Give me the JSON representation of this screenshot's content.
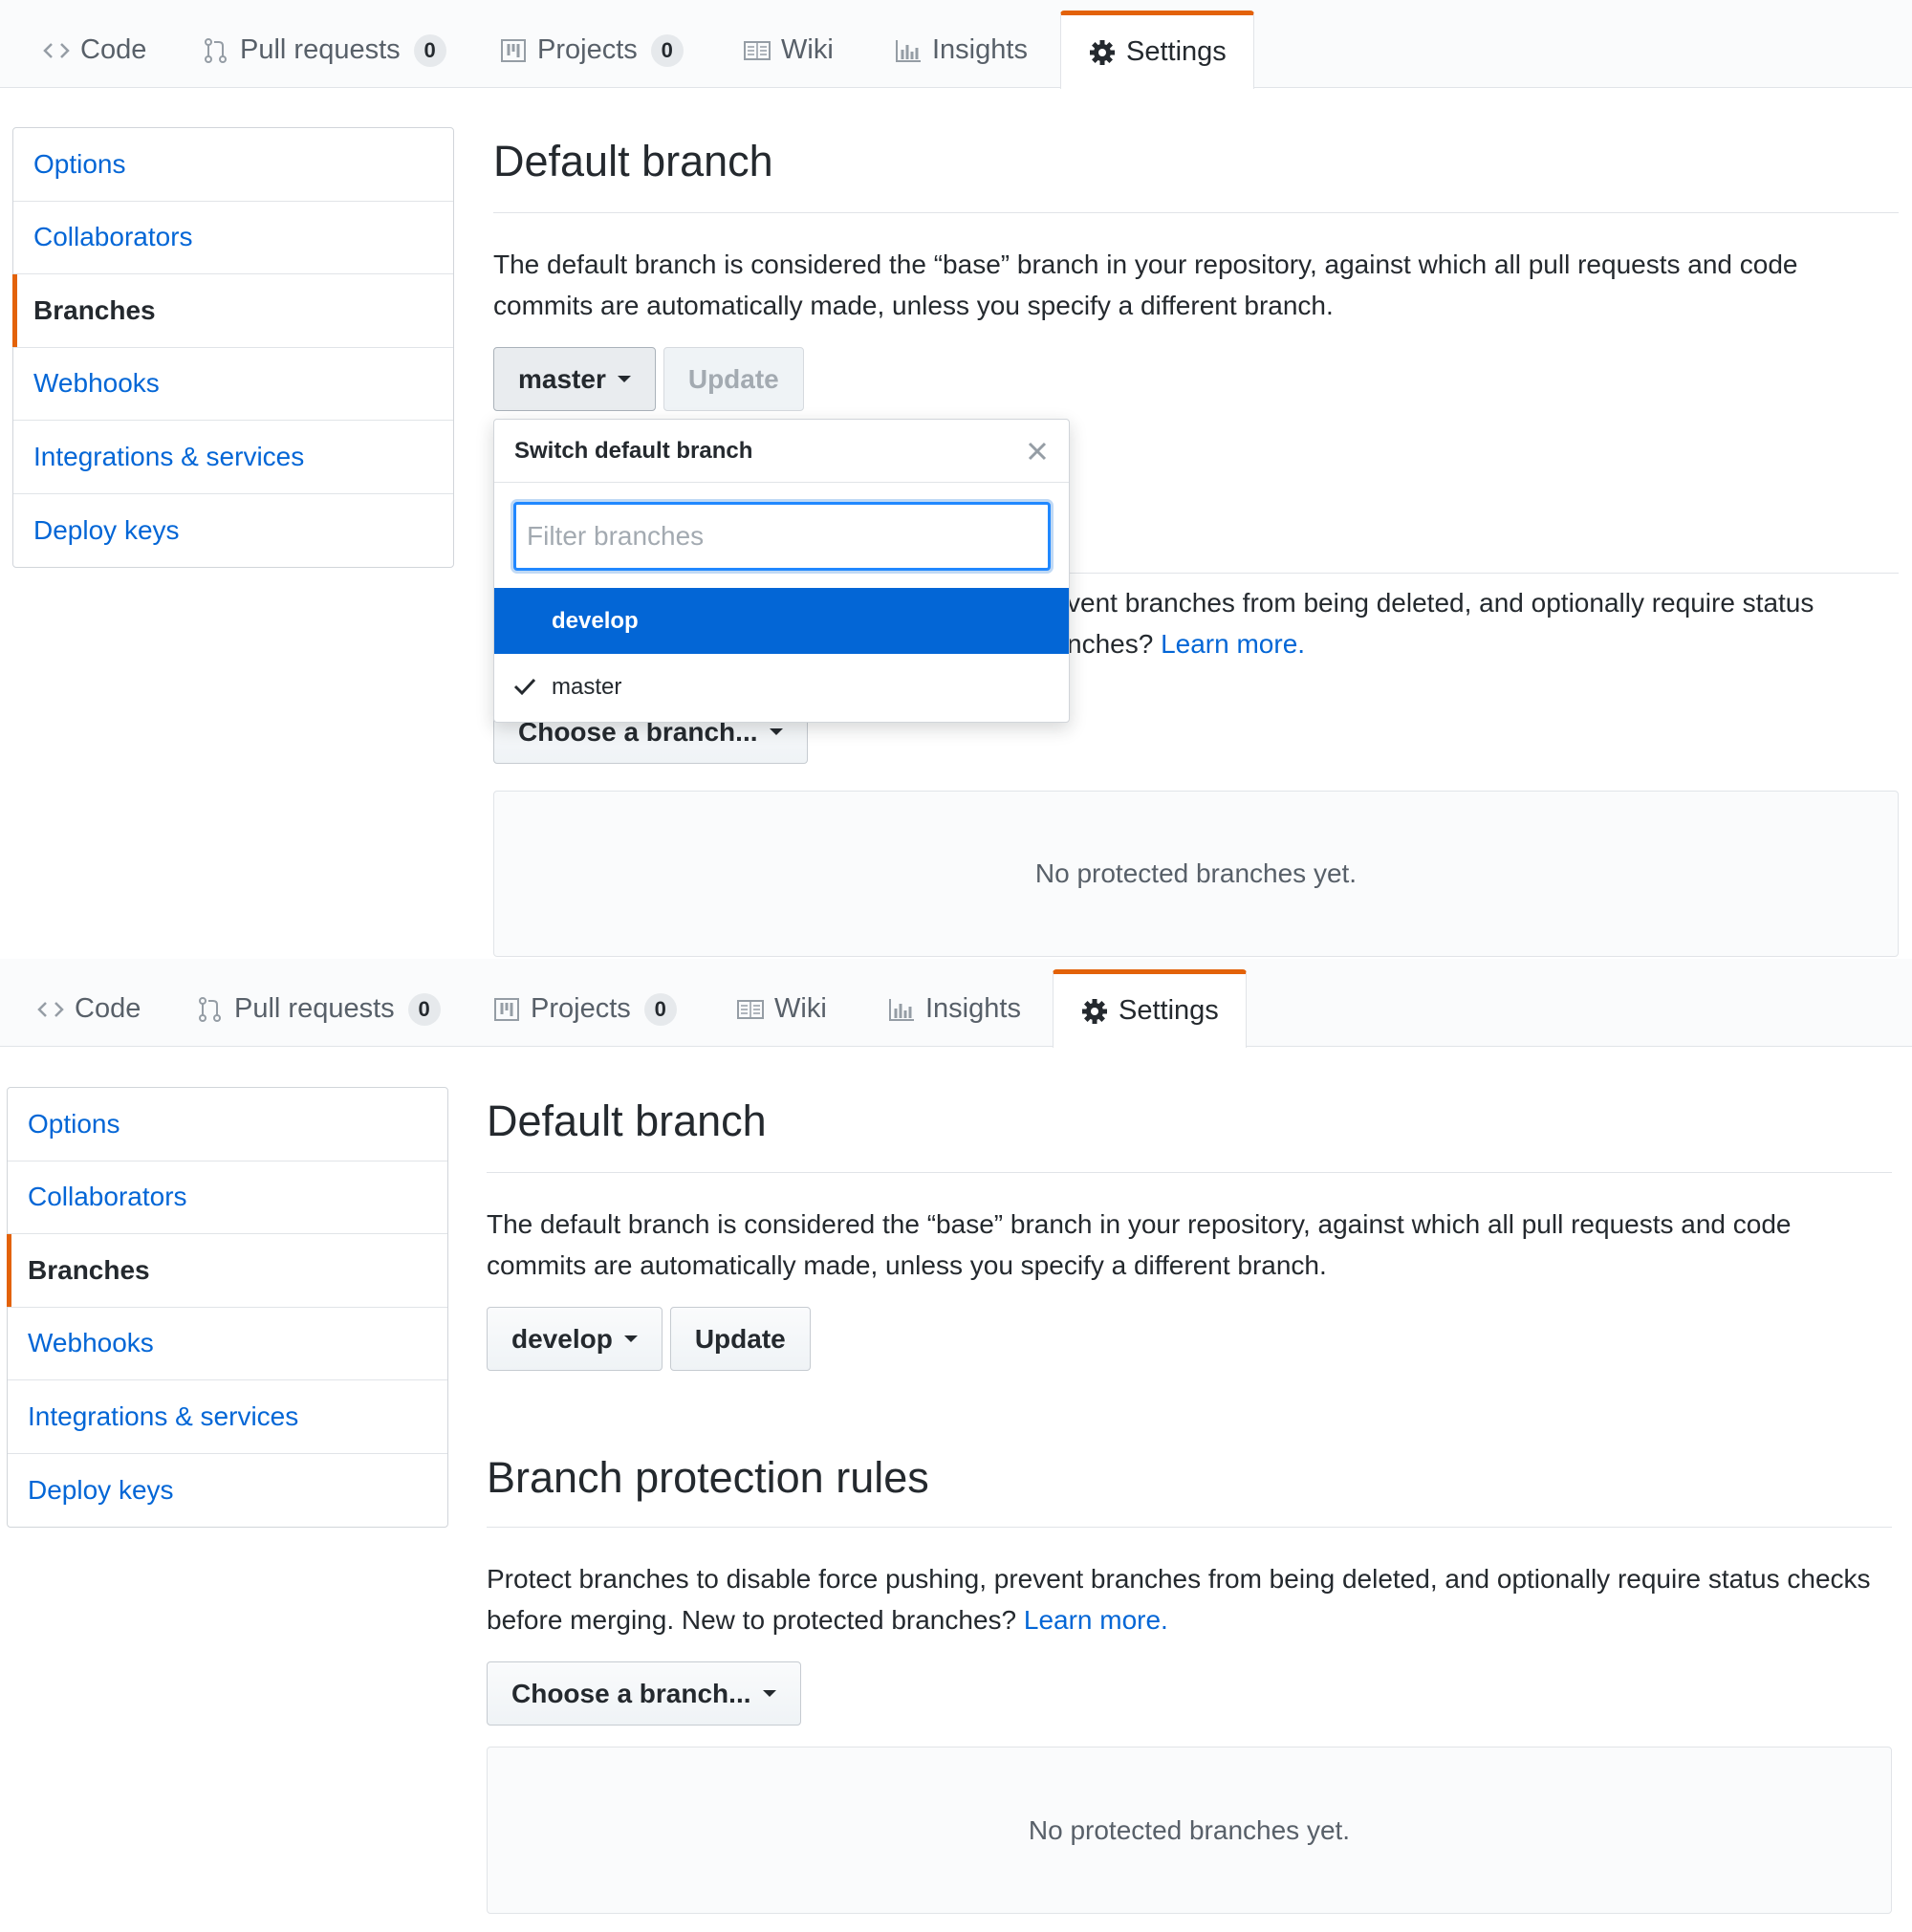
{
  "nav": {
    "tabs": [
      {
        "label": "Code",
        "icon": "code-icon"
      },
      {
        "label": "Pull requests",
        "icon": "pull-request-icon",
        "count": "0"
      },
      {
        "label": "Projects",
        "icon": "project-icon",
        "count": "0"
      },
      {
        "label": "Wiki",
        "icon": "book-icon"
      },
      {
        "label": "Insights",
        "icon": "graph-icon"
      },
      {
        "label": "Settings",
        "icon": "gear-icon",
        "selected": true
      }
    ]
  },
  "sidebar": {
    "items": [
      {
        "label": "Options"
      },
      {
        "label": "Collaborators"
      },
      {
        "label": "Branches",
        "selected": true
      },
      {
        "label": "Webhooks"
      },
      {
        "label": "Integrations & services"
      },
      {
        "label": "Deploy keys"
      }
    ]
  },
  "default_branch": {
    "title": "Default branch",
    "description": "The default branch is considered the “base” branch in your repository, against which all pull requests and code commits are automatically made, unless you specify a different branch.",
    "update_label": "Update"
  },
  "panel1": {
    "selected_branch": "master",
    "dropdown": {
      "title": "Switch default branch",
      "filter_placeholder": "Filter branches",
      "items": [
        {
          "label": "develop",
          "highlighted": true
        },
        {
          "label": "master",
          "checked": true
        }
      ]
    },
    "hidden_para_fragment_1": "vent branches from being deleted, and optionally require status",
    "hidden_para_fragment_2": "nches?"
  },
  "panel2": {
    "selected_branch": "develop"
  },
  "protection": {
    "title": "Branch protection rules",
    "description": "Protect branches to disable force pushing, prevent branches from being deleted, and optionally require status checks before merging. New to protected branches?",
    "learn_more": "Learn more.",
    "choose_label": "Choose a branch...",
    "empty": "No protected branches yet."
  },
  "colors": {
    "accent": "#e36209",
    "link": "#0366d6",
    "focus": "#2188ff"
  }
}
